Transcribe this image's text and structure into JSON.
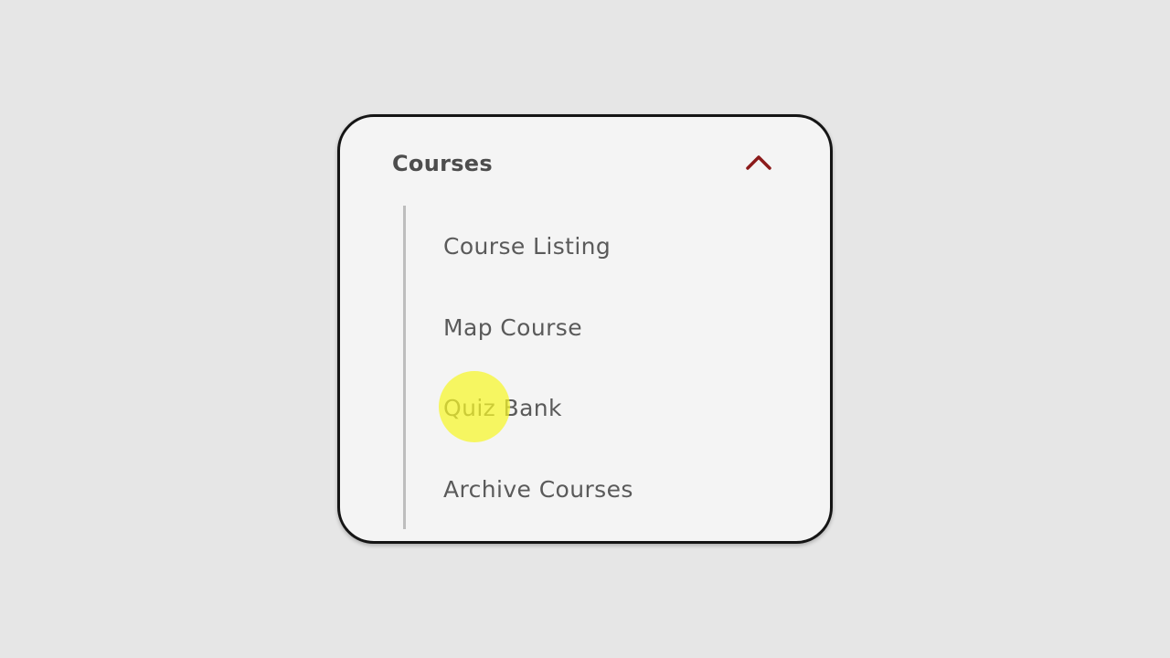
{
  "panel": {
    "title": "Courses",
    "toggle_icon": "chevron-up-icon",
    "accent_color": "#8b1a1a",
    "expanded": true
  },
  "menu": {
    "items": [
      {
        "label": "Course Listing"
      },
      {
        "label": "Map Course"
      },
      {
        "label": "Quiz Bank"
      },
      {
        "label": "Archive Courses"
      }
    ]
  },
  "cursor": {
    "highlight_color": "#f7f728",
    "target": "Quiz Bank"
  }
}
